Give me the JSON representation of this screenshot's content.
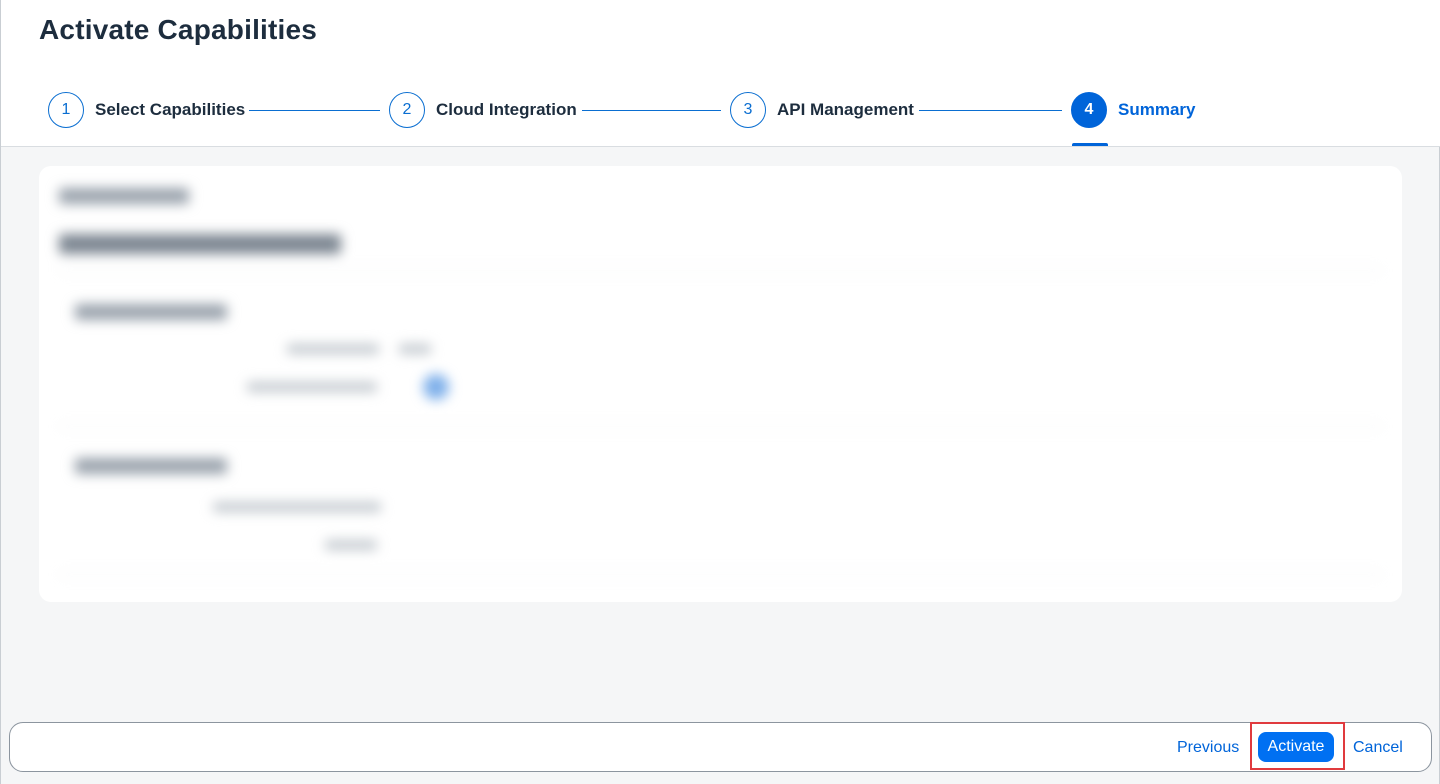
{
  "dialog": {
    "title": "Activate Capabilities"
  },
  "wizard": {
    "steps": [
      {
        "number": "1",
        "label": "Select Capabilities",
        "state": "completed"
      },
      {
        "number": "2",
        "label": "Cloud Integration",
        "state": "completed"
      },
      {
        "number": "3",
        "label": "API Management",
        "state": "completed"
      },
      {
        "number": "4",
        "label": "Summary",
        "state": "active"
      }
    ],
    "accent_color": "#0064d9"
  },
  "footer": {
    "previous_label": "Previous",
    "activate_label": "Activate",
    "cancel_label": "Cancel"
  },
  "colors": {
    "primary_button": "#0070f2",
    "link": "#0064d9",
    "highlight": "#e03a3e"
  }
}
